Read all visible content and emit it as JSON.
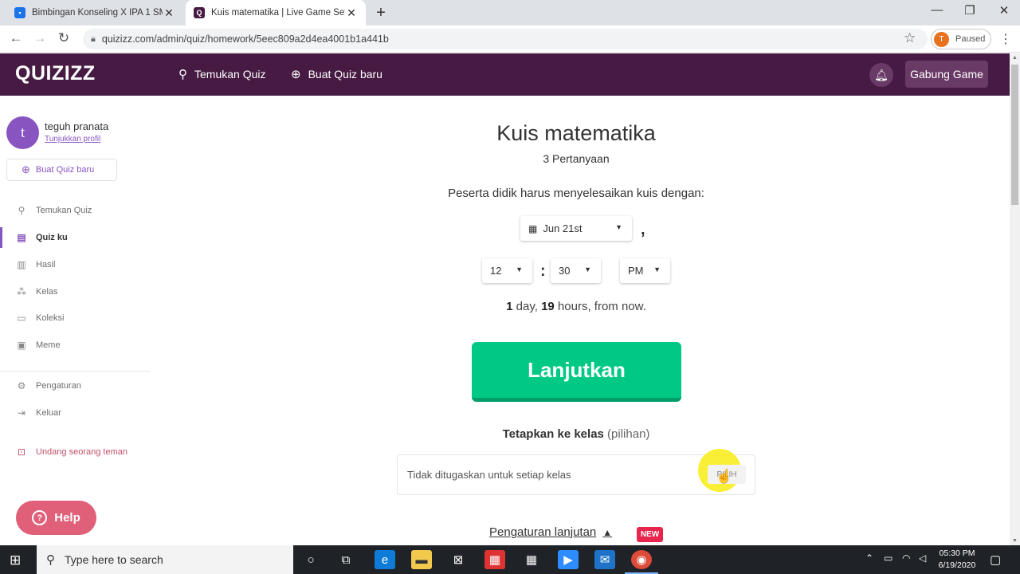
{
  "browser": {
    "tabs": [
      {
        "title": "Bimbingan Konseling X IPA 1 SM",
        "favicon_color": "#1a73e8"
      },
      {
        "title": "Kuis matematika | Live Game Setti",
        "favicon_color": "#461a42"
      }
    ],
    "url": "quizizz.com/admin/quiz/homework/5eec809a2d4ea4001b1a441b",
    "profile_initial": "T",
    "profile_status": "Paused"
  },
  "header": {
    "logo": "QUIZIZZ",
    "nav": [
      "Temukan Quiz",
      "Buat Quiz baru"
    ],
    "join_button": "Gabung Game"
  },
  "sidebar": {
    "avatar_initial": "t",
    "user_name": "teguh pranata",
    "profile_link": "Tunjukkan profil",
    "new_quiz": "Buat Quiz baru",
    "items": [
      {
        "label": "Temukan Quiz",
        "icon": "search-icon"
      },
      {
        "label": "Quiz ku",
        "icon": "document-icon",
        "active": true
      },
      {
        "label": "Hasil",
        "icon": "bar-chart-icon"
      },
      {
        "label": "Kelas",
        "icon": "class-icon"
      },
      {
        "label": "Koleksi",
        "icon": "folder-icon"
      },
      {
        "label": "Meme",
        "icon": "image-icon"
      }
    ],
    "settings": "Pengaturan",
    "logout": "Keluar",
    "invite": "Undang seorang teman",
    "help": "Help"
  },
  "main": {
    "quiz_title": "Kuis matematika",
    "question_count": "3 Pertanyaan",
    "deadline_label": "Peserta didik harus menyelesaikan kuis dengan:",
    "date": "Jun 21st",
    "date_separator": ",",
    "hour": "12",
    "time_separator": ":",
    "minute": "30",
    "ampm": "PM",
    "relative": {
      "days": "1",
      "days_unit": " day, ",
      "hours": "19",
      "hours_unit": " hours, from now."
    },
    "continue_button": "Lanjutkan",
    "assign_label": "Tetapkan ke kelas",
    "assign_optional": "(pilihan)",
    "assign_placeholder": "Tidak ditugaskan untuk setiap kelas",
    "pick_button": "PILIH",
    "advanced_settings": "Pengaturan lanjutan",
    "new_badge": "NEW"
  },
  "taskbar": {
    "search_placeholder": "Type here to search",
    "time": "05:30 PM",
    "date": "6/19/2020"
  }
}
